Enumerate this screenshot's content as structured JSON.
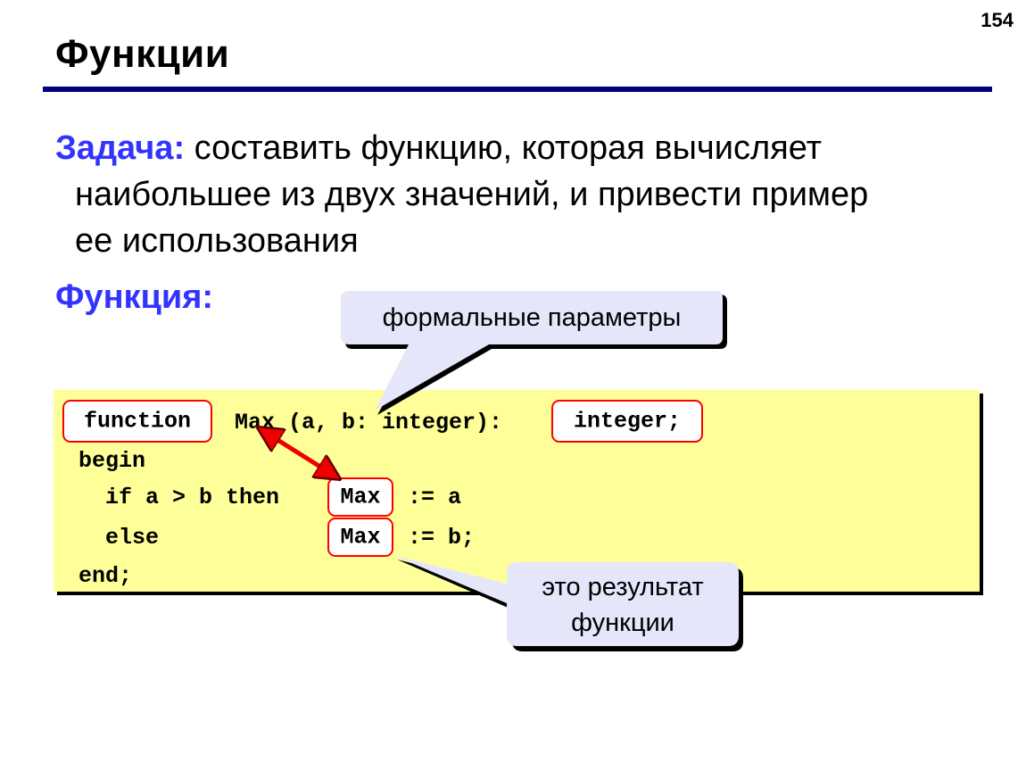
{
  "page_number": "154",
  "title": "Функции",
  "task": {
    "label": "Задача:",
    "line1": " составить функцию, которая вычисляет",
    "line2": "наибольшее из двух значений, и привести пример",
    "line3": "ее использования"
  },
  "function_label": "Функция:",
  "code": {
    "line1_mid": " Max (a, b: integer):",
    "line2": "begin",
    "line3_pre": "  if a > b then",
    "line3_post": " := a",
    "line4_pre": "  else",
    "line4_post": " := b;",
    "line5": "end;",
    "kw_function": "function",
    "kw_return_type": "integer;",
    "result_name_1": "Max",
    "result_name_2": "Max"
  },
  "callouts": {
    "formal_params": "формальные параметры",
    "result_line1": "это результат",
    "result_line2": "функции"
  },
  "colors": {
    "title_rule": "#000080",
    "accent_blue": "#3333ff",
    "code_bg": "#ffff99",
    "highlight_border": "#ff0000",
    "callout_bg": "#e6e6fa",
    "arrow": "#ee0000"
  }
}
